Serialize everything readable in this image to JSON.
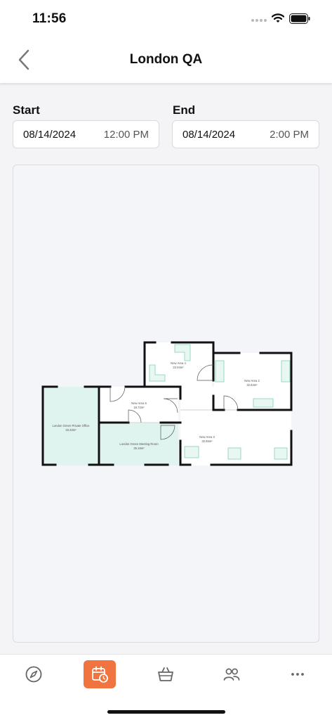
{
  "status_bar": {
    "time": "11:56"
  },
  "header": {
    "title": "London QA",
    "back_icon": "chevron-left-icon"
  },
  "start": {
    "label": "Start",
    "date": "08/14/2024",
    "time": "12:00 PM"
  },
  "end": {
    "label": "End",
    "date": "08/14/2024",
    "time": "2:00 PM"
  },
  "floor_plan": {
    "rooms": [
      {
        "name": "London Green Private Office",
        "area": "33.33m²"
      },
      {
        "name": "New Area 6",
        "area": "18.72m²"
      },
      {
        "name": "London Green Meeting Room",
        "area": "25.16m²"
      },
      {
        "name": "New Area 4",
        "area": "22.04m²"
      },
      {
        "name": "New Area 2",
        "area": "32.64m²"
      },
      {
        "name": "New Area 3",
        "area": "32.65m²"
      }
    ],
    "colors": {
      "highlight": "#dff3ef",
      "wall": "#111111",
      "furniture": "#7fd1bc"
    }
  },
  "tab_bar": {
    "items": [
      {
        "icon": "compass-icon",
        "active": false
      },
      {
        "icon": "calendar-clock-icon",
        "active": true
      },
      {
        "icon": "basket-icon",
        "active": false
      },
      {
        "icon": "people-icon",
        "active": false
      },
      {
        "icon": "more-icon",
        "active": false
      }
    ],
    "accent": "#f0743f"
  }
}
